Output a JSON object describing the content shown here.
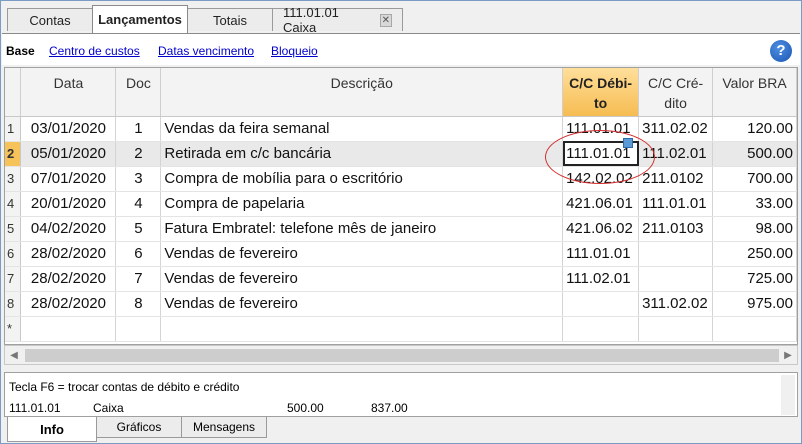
{
  "tabs": [
    {
      "label": "Contas",
      "active": false
    },
    {
      "label": "Lançamentos",
      "active": true
    },
    {
      "label": "Totais",
      "active": false
    },
    {
      "label": "111.01.01 Caixa",
      "active": false,
      "closable": true
    }
  ],
  "views": {
    "base": "Base",
    "links": [
      "Centro de custos",
      "Datas vencimento",
      "Bloqueio"
    ]
  },
  "help_icon": "help-question-icon",
  "table": {
    "headers": [
      "Data",
      "Doc",
      "Descrição",
      "C/C Débi-to",
      "C/C Cré-dito",
      "Valor BRA"
    ],
    "header_lines": [
      [
        "Data"
      ],
      [
        "Doc"
      ],
      [
        "Descrição"
      ],
      [
        "C/C Débi-",
        "to"
      ],
      [
        "C/C Cré-",
        "dito"
      ],
      [
        "Valor BRA"
      ]
    ],
    "selected_header": 3,
    "current_row": 2,
    "active_cell": {
      "row": 2,
      "column": 3
    },
    "rows": [
      {
        "n": "1",
        "data": "03/01/2020",
        "doc": "1",
        "descricao": "Vendas da feira semanal",
        "debito": "111.01.01",
        "credito": "311.02.02",
        "valor": "120.00"
      },
      {
        "n": "2",
        "data": "05/01/2020",
        "doc": "2",
        "descricao": "Retirada em  c/c bancária",
        "debito": "111.01.01",
        "credito": "111.02.01",
        "valor": "500.00"
      },
      {
        "n": "3",
        "data": "07/01/2020",
        "doc": "3",
        "descricao": "Compra de mobília para o escritório",
        "debito": "142.02.02",
        "credito": "211.0102",
        "valor": "700.00"
      },
      {
        "n": "4",
        "data": "20/01/2020",
        "doc": "4",
        "descricao": "Compra de papelaria",
        "debito": "421.06.01",
        "credito": "111.01.01",
        "valor": "33.00"
      },
      {
        "n": "5",
        "data": "04/02/2020",
        "doc": "5",
        "descricao": "Fatura Embratel: telefone mês de janeiro",
        "debito": "421.06.02",
        "credito": "211.0103",
        "valor": "98.00"
      },
      {
        "n": "6",
        "data": "28/02/2020",
        "doc": "6",
        "descricao": "Vendas de fevereiro",
        "debito": "111.01.01",
        "credito": "",
        "valor": "250.00"
      },
      {
        "n": "7",
        "data": "28/02/2020",
        "doc": "7",
        "descricao": "Vendas de fevereiro",
        "debito": "111.02.01",
        "credito": "",
        "valor": "725.00"
      },
      {
        "n": "8",
        "data": "28/02/2020",
        "doc": "8",
        "descricao": "Vendas de fevereiro",
        "debito": "",
        "credito": "311.02.02",
        "valor": "975.00"
      },
      {
        "n": "*",
        "data": "",
        "doc": "",
        "descricao": "",
        "debito": "",
        "credito": "",
        "valor": ""
      }
    ]
  },
  "info": {
    "hint": "Tecla F6 = trocar contas de débito e crédito",
    "account": "111.01.01",
    "name": "Caixa",
    "value1": "500.00",
    "value2": "837.00"
  },
  "bottom_tabs": [
    {
      "label": "Info",
      "active": true
    },
    {
      "label": "Gráficos",
      "active": false
    },
    {
      "label": "Mensagens",
      "active": false
    }
  ],
  "colors": {
    "selected_header": "#f6bc52",
    "link": "#0000cc",
    "annotation": "#d32f2f"
  }
}
